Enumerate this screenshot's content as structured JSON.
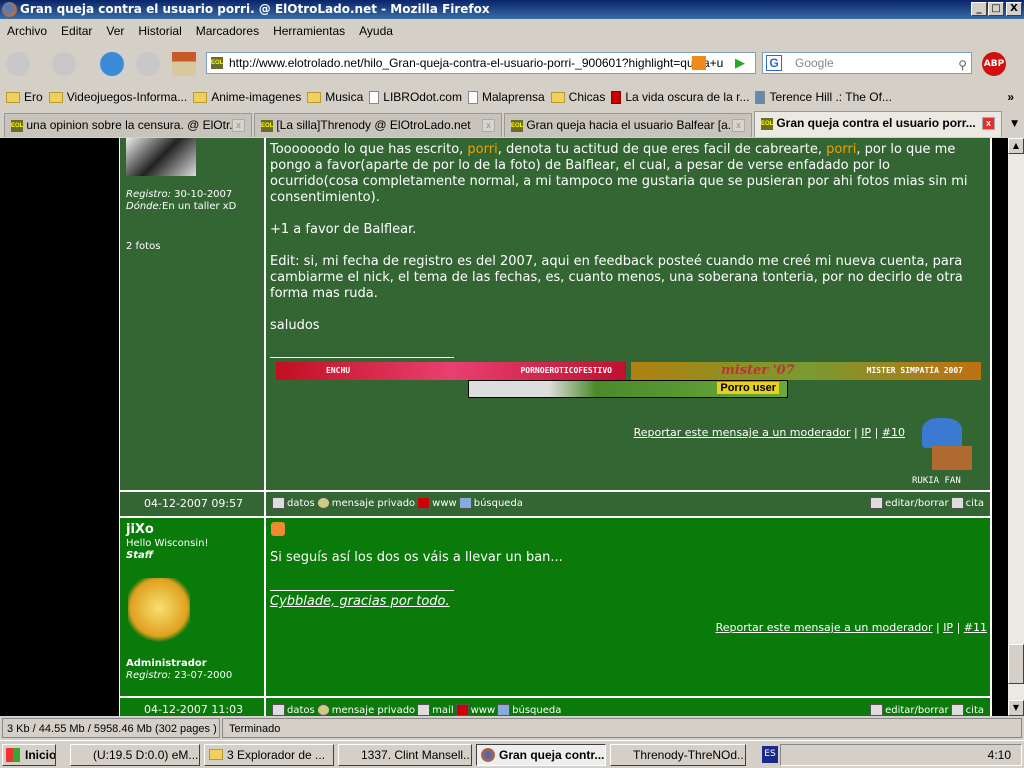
{
  "window": {
    "title": "Gran queja contra el usuario porri. @ ElOtroLado.net - Mozilla Firefox",
    "min": "_",
    "max": "□",
    "close": "X"
  },
  "menu": [
    "Archivo",
    "Editar",
    "Ver",
    "Historial",
    "Marcadores",
    "Herramientas",
    "Ayuda"
  ],
  "url": "http://www.elotrolado.net/hilo_Gran-queja-contra-el-usuario-porri-_900601?highlight=queja+u",
  "search_placeholder": "Google",
  "bookmarks": [
    "Ero",
    "Videojuegos-Informa...",
    "Anime-imagenes",
    "Musica",
    "LIBROdot.com",
    "Malaprensa",
    "Chicas",
    "La vida oscura de la r...",
    "Terence Hill .: The Of..."
  ],
  "bookmarks_more": "»",
  "tabs": [
    {
      "label": "una opinion sobre la censura. @ ElOtr..."
    },
    {
      "label": "[La silla]Threnody @ ElOtroLado.net"
    },
    {
      "label": "Gran queja hacia el usuario Balfear [a..."
    },
    {
      "label": "Gran queja contra el usuario porr..."
    }
  ],
  "favicon": "EOL",
  "post1": {
    "registro_label": "Registro:",
    "registro": "30-10-2007",
    "donde_label": "Dónde:",
    "donde": "En un taller xD",
    "fotos": "2 fotos",
    "p1a": "Toooooodo lo que has escrito, ",
    "porri": "porri",
    "p1b": ", denota tu actitud de que eres facil de cabrearte, ",
    "p1c": ", por lo que me pongo a favor(aparte de por lo de la foto) de Balflear, el cual, a pesar de verse enfadado por lo ocurrido(cosa completamente normal, a mi tampoco me gustaria que se pusieran por ahi fotos mias sin mi consentimiento).",
    "p2": "+1 a favor de Balflear.",
    "p3": "Edit: si, mi fecha de registro es del 2007, aqui en feedback posteé cuando me creé mi nueva cuenta, para cambiarme el nick, el tema de las fechas, es, cuanto menos, una soberana tonteria, por no decirlo de otra forma mas ruda.",
    "p4": "saludos",
    "banner1_left": "ENCHU",
    "banner1_right": "PORNOEROTICOFESTIVO",
    "banner2_left": "mister '07",
    "banner2_right": "MISTER SIMPATÍA 2007",
    "banner3": "Porro user",
    "report": "Reportar este mensaje a un moderador",
    "ip": "IP",
    "num": "#10",
    "badge": "RUKIA FAN",
    "date": "04-12-2007 09:57",
    "footer": [
      "datos",
      "mensaje privado",
      "www",
      "búsqueda"
    ],
    "edit": "editar/borrar",
    "cita": "cita"
  },
  "post2": {
    "user": "jiXo",
    "subtitle": "Hello Wisconsin!",
    "rank": "Staff",
    "role": "Administrador",
    "registro_label": "Registro:",
    "registro": "23-07-2000",
    "text": "Si seguís así los dos os váis a llevar un ban...",
    "signature": "Cybblade, gracias por todo.",
    "report": "Reportar este mensaje a un moderador",
    "ip": "IP",
    "num": "#11",
    "date": "04-12-2007 11:03",
    "footer": [
      "datos",
      "mensaje privado",
      "mail",
      "www",
      "búsqueda"
    ],
    "edit": "editar/borrar",
    "cita": "cita"
  },
  "status": {
    "left": "3 Kb / 44.55 Mb / 5958.46 Mb (302 pages )",
    "right": "Terminado"
  },
  "taskbar": {
    "start": "Inicio",
    "items": [
      "(U:19.5 D:0.0) eM...",
      "3 Explorador de ...",
      "1337. Clint Mansell...",
      "Gran queja contr...",
      "Threnody-ThreNOd..."
    ],
    "lang": "ES",
    "clock": "4:10"
  }
}
